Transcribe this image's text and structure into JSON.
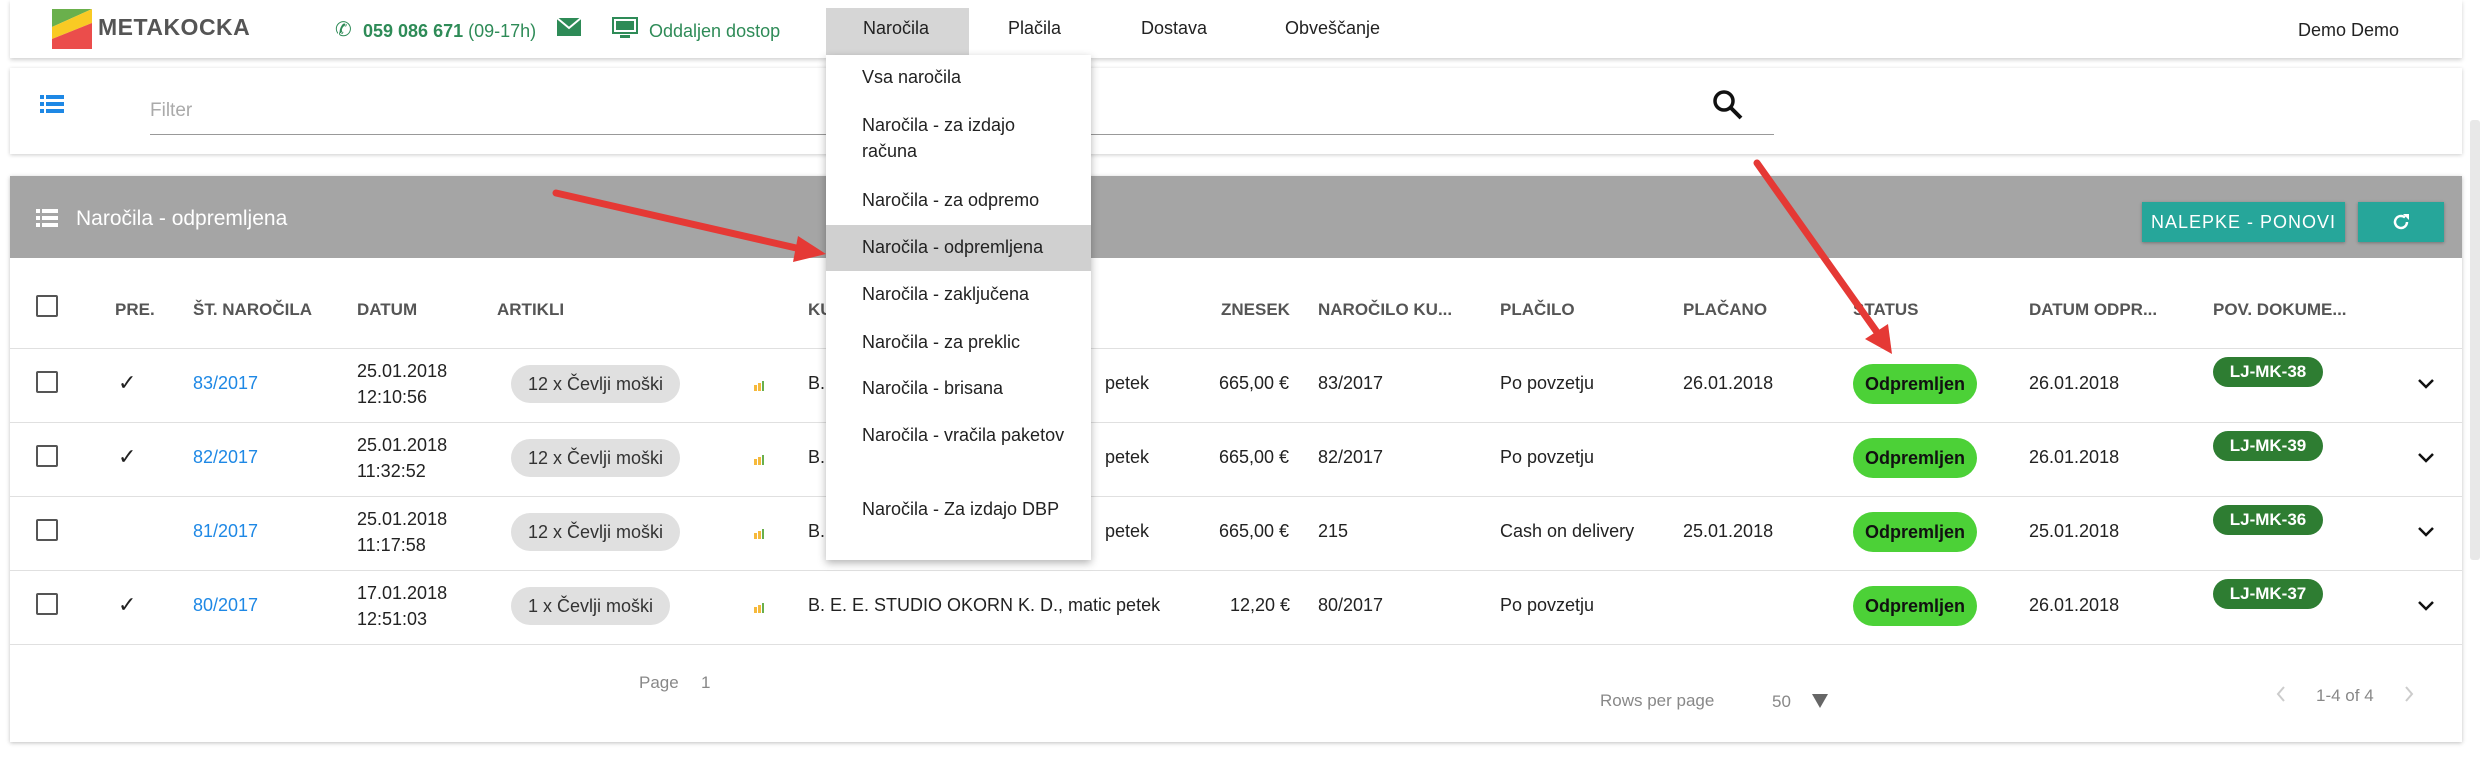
{
  "header": {
    "logo": "METAKOCKA",
    "phone": "059 086 671",
    "phone_hours": "(09-17h)",
    "remote": "Oddaljen dostop",
    "nav": [
      "Naročila",
      "Plačila",
      "Dostava",
      "Obveščanje"
    ],
    "user": "Demo Demo"
  },
  "filter": {
    "placeholder": "Filter"
  },
  "dropdown": {
    "items": [
      "Vsa naročila",
      "Naročila - za izdajo računa",
      "Naročila - za odpremo",
      "Naročila - odpremljena",
      "Naročila - zaključena",
      "Naročila - za preklic",
      "Naročila - brisana",
      "Naročila - vračila paketov",
      "Naročila - Za izdajo DBP"
    ],
    "selected": "Naročila - odpremljena"
  },
  "card": {
    "title": "Naročila - odpremljena",
    "labels_button": "NALEPKE - PONOVI",
    "refresh_icon": "refresh-icon"
  },
  "table": {
    "columns": [
      "PRE.",
      "ŠT. NAROČILA",
      "DATUM",
      "ARTIKLI",
      "KU",
      "ZNESEK",
      "NAROČILO KU...",
      "PLAČILO",
      "PLAČANO",
      "STATUS",
      "DATUM ODPR...",
      "POV. DOKUME..."
    ],
    "rows": [
      {
        "pre": "✓",
        "number": "83/2017",
        "date": "25.01.2018",
        "time": "12:10:56",
        "items": "12 x Čevlji moški",
        "customer_a": "B.",
        "customer_b": "petek",
        "amount": "665,00 €",
        "cust_order": "83/2017",
        "payment": "Po povzetju",
        "paid": "26.01.2018",
        "status": "Odpremljen",
        "ship_date": "26.01.2018",
        "doc": "LJ-MK-38"
      },
      {
        "pre": "✓",
        "number": "82/2017",
        "date": "25.01.2018",
        "time": "11:32:52",
        "items": "12 x Čevlji moški",
        "customer_a": "B.",
        "customer_b": "petek",
        "amount": "665,00 €",
        "cust_order": "82/2017",
        "payment": "Po povzetju",
        "paid": "",
        "status": "Odpremljen",
        "ship_date": "26.01.2018",
        "doc": "LJ-MK-39"
      },
      {
        "pre": "",
        "number": "81/2017",
        "date": "25.01.2018",
        "time": "11:17:58",
        "items": "12 x Čevlji moški",
        "customer_a": "B.",
        "customer_b": "petek",
        "amount": "665,00 €",
        "cust_order": "215",
        "payment": "Cash on delivery",
        "paid": "25.01.2018",
        "status": "Odpremljen",
        "ship_date": "25.01.2018",
        "doc": "LJ-MK-36"
      },
      {
        "pre": "✓",
        "number": "80/2017",
        "date": "17.01.2018",
        "time": "12:51:03",
        "items": "1 x Čevlji moški",
        "customer_a": "B. E. E. STUDIO OKORN K. D., matic petek",
        "customer_b": "",
        "amount": "12,20 €",
        "cust_order": "80/2017",
        "payment": "Po povzetju",
        "paid": "",
        "status": "Odpremljen",
        "ship_date": "26.01.2018",
        "doc": "LJ-MK-37"
      }
    ]
  },
  "footer": {
    "page_label": "Page",
    "page_value": "1",
    "rows_label": "Rows per page",
    "rows_value": "50",
    "range": "1-4 of 4"
  },
  "colors": {
    "accent": "#26a69a",
    "status": "#4cd137",
    "doc": "#2e7d32",
    "link": "#1e88e5",
    "arrow": "#e53935"
  }
}
